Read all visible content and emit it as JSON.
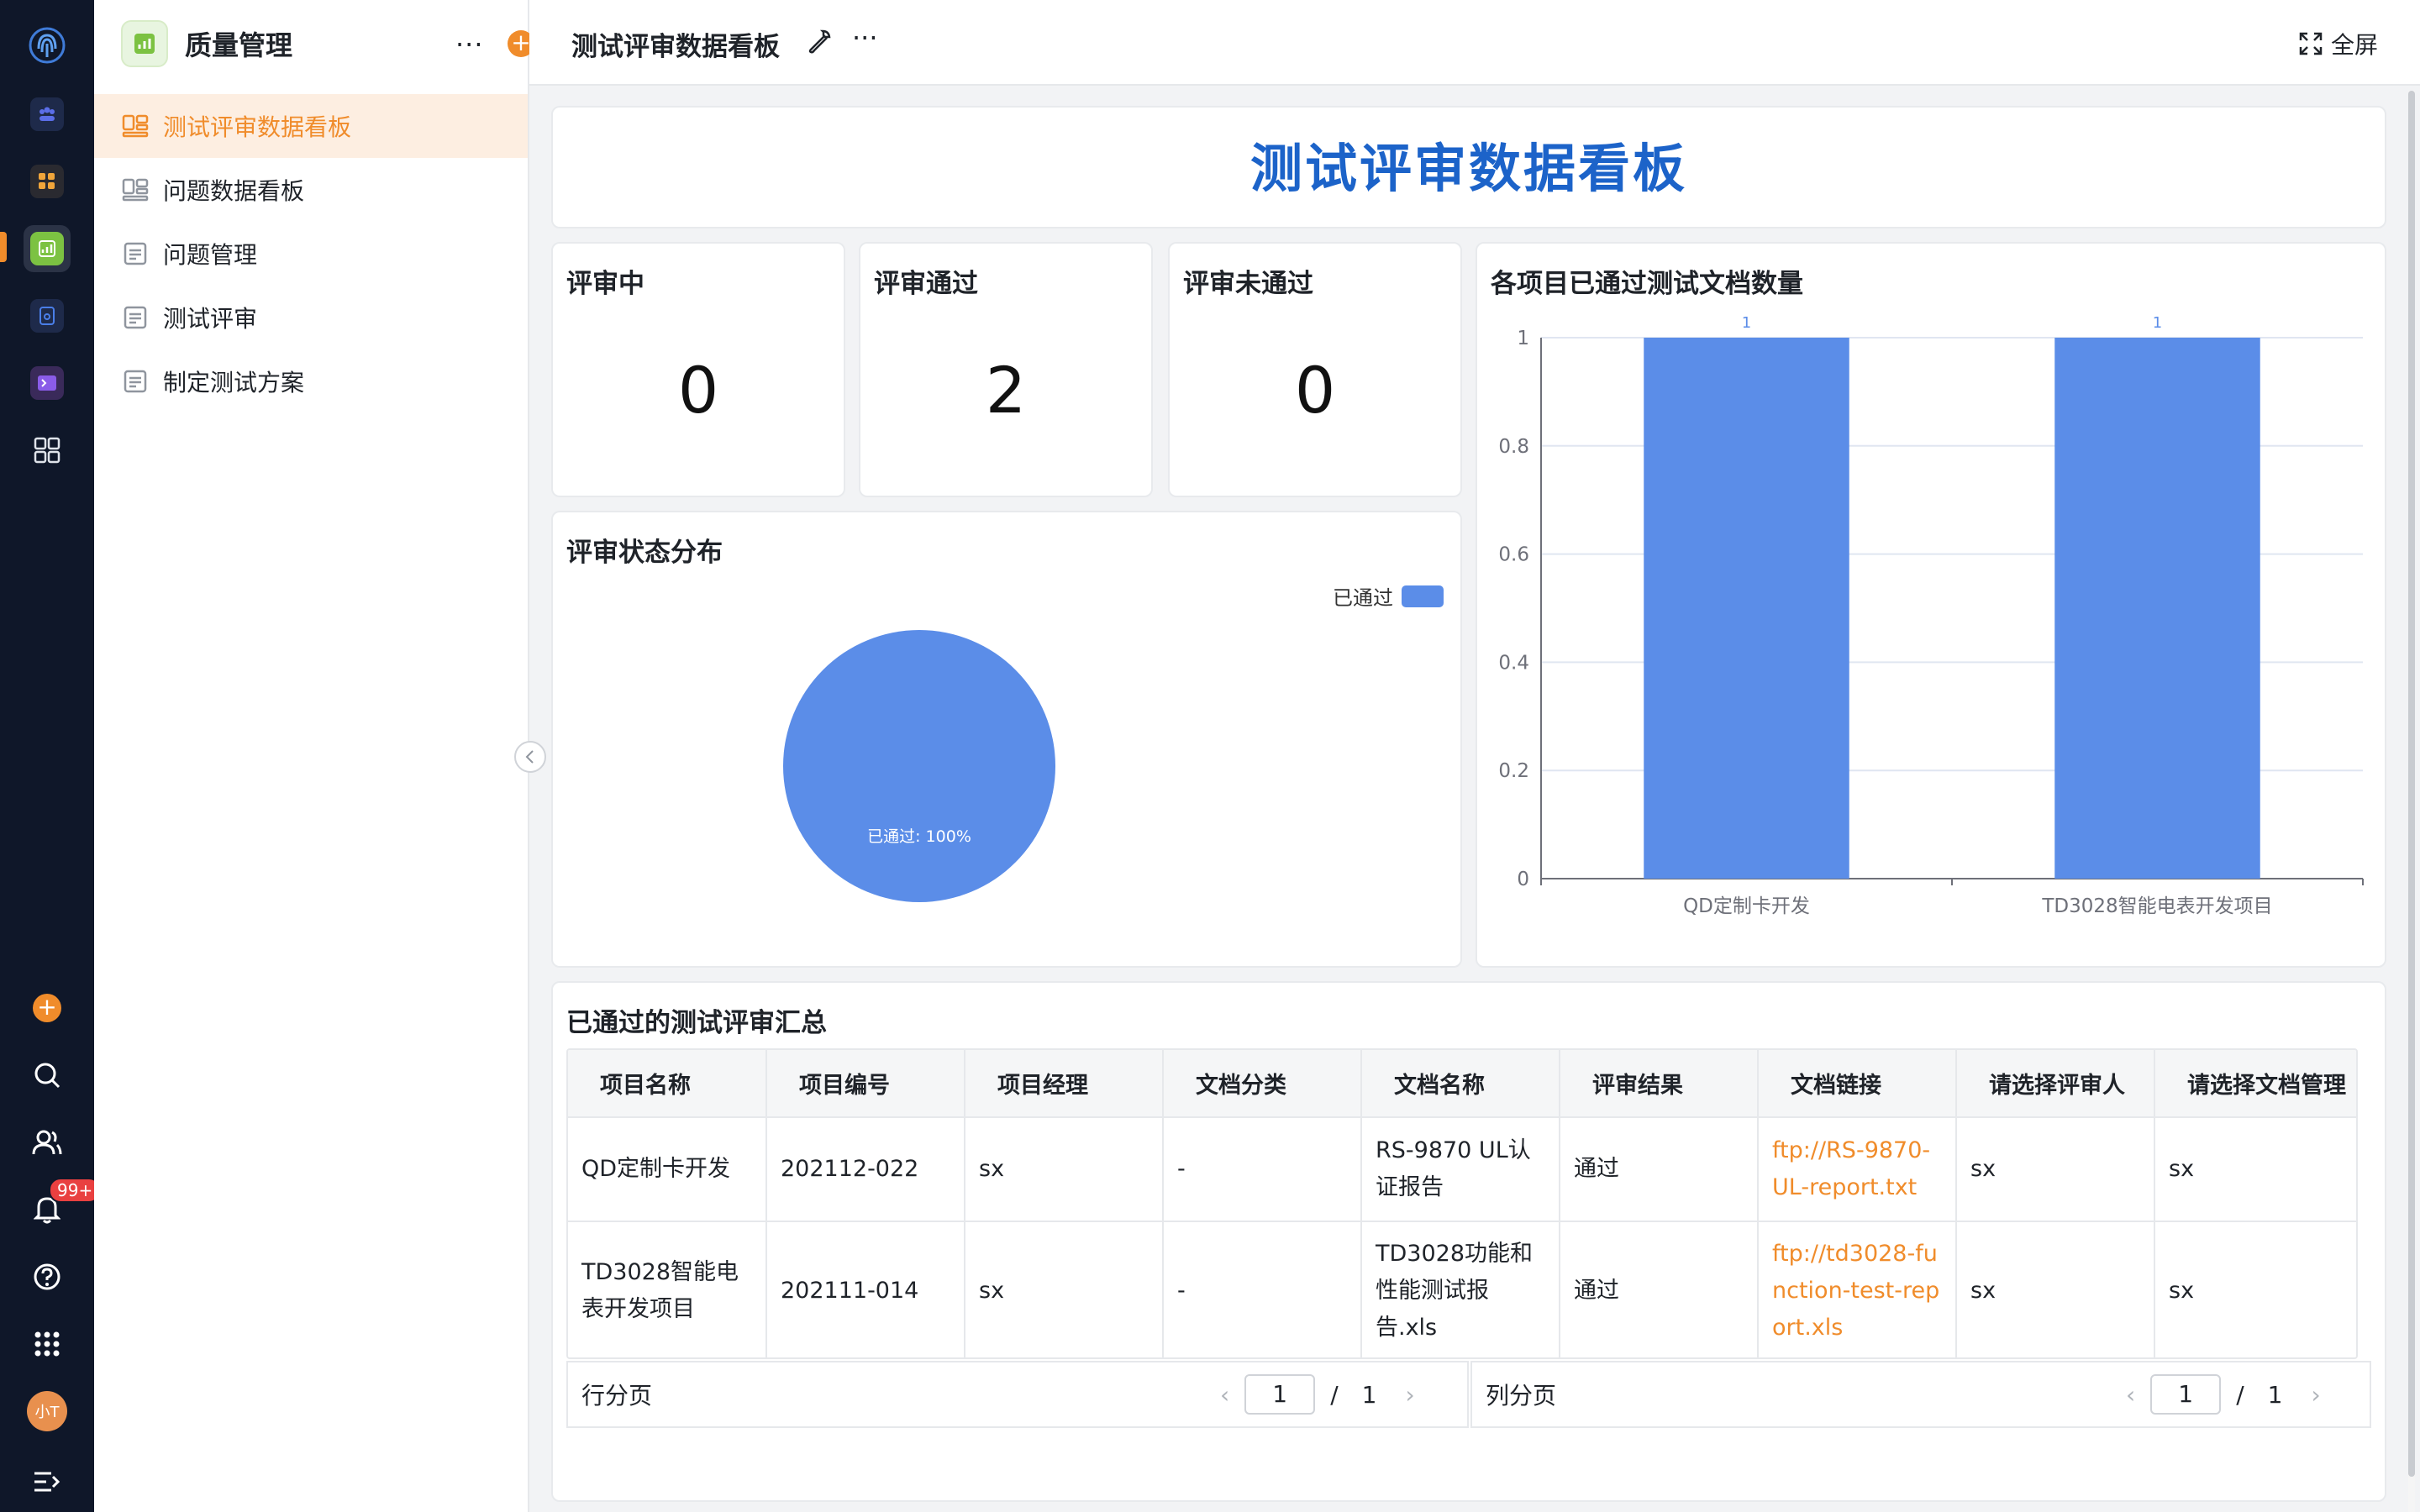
{
  "rail": {
    "notifications_badge": "99+",
    "avatar_text": "小T",
    "active_color": "#f08c2b"
  },
  "sidebar": {
    "app_title": "质量管理",
    "items": [
      {
        "label": "测试评审数据看板",
        "icon": "dashboard-icon",
        "active": true
      },
      {
        "label": "问题数据看板",
        "icon": "dashboard-icon",
        "active": false
      },
      {
        "label": "问题管理",
        "icon": "table-icon",
        "active": false
      },
      {
        "label": "测试评审",
        "icon": "table-icon",
        "active": false
      },
      {
        "label": "制定测试方案",
        "icon": "table-icon",
        "active": false
      }
    ]
  },
  "topbar": {
    "title": "测试评审数据看板",
    "fullscreen_label": "全屏"
  },
  "dashboard": {
    "banner_title": "测试评审数据看板",
    "stats": [
      {
        "label": "评审中",
        "value": "0"
      },
      {
        "label": "评审通过",
        "value": "2"
      },
      {
        "label": "评审未通过",
        "value": "0"
      }
    ],
    "accent_color": "#1c63c9",
    "series_color": "#5b8de8"
  },
  "chart_data": [
    {
      "type": "pie",
      "title": "评审状态分布",
      "legend": [
        "已通过"
      ],
      "legend_position": "top-right",
      "slices": [
        {
          "name": "已通过",
          "value": 100,
          "label": "已通过: 100%"
        }
      ]
    },
    {
      "type": "bar",
      "title": "各项目已通过测试文档数量",
      "categories": [
        "QD定制卡开发",
        "TD3028智能电表开发项目"
      ],
      "values": [
        1,
        1
      ],
      "data_labels": [
        "1",
        "1"
      ],
      "ylim": [
        0,
        1
      ],
      "yticks": [
        "0",
        "0.2",
        "0.4",
        "0.6",
        "0.8",
        "1"
      ],
      "grid": true
    }
  ],
  "table": {
    "title": "已通过的测试评审汇总",
    "columns": [
      "项目名称",
      "项目编号",
      "项目经理",
      "文档分类",
      "文档名称",
      "评审结果",
      "文档链接",
      "请选择评审人",
      "请选择文档管理"
    ],
    "rows": [
      [
        "QD定制卡开发",
        "202112-022",
        "sx",
        "-",
        "RS-9870 UL认证报告",
        "通过",
        "ftp://RS-9870-UL-report.txt",
        "sx",
        "sx"
      ],
      [
        "TD3028智能电表开发项目",
        "202111-014",
        "sx",
        "-",
        "TD3028功能和性能测试报告.xls",
        "通过",
        "ftp://td3028-function-test-report.xls",
        "sx",
        "sx"
      ]
    ],
    "row_pager": {
      "label": "行分页",
      "page": "1",
      "sep": "/",
      "total": "1"
    },
    "col_pager": {
      "label": "列分页",
      "page": "1",
      "sep": "/",
      "total": "1"
    }
  }
}
